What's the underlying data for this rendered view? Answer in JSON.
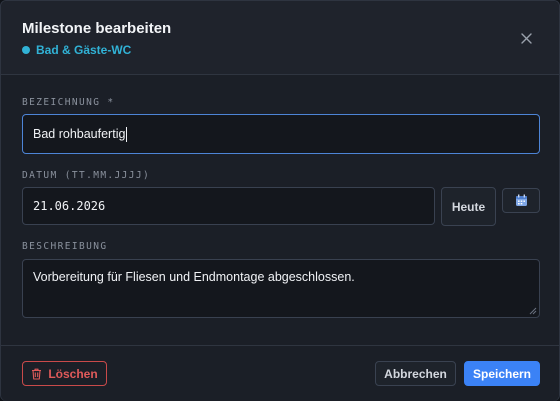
{
  "dialog": {
    "title": "Milestone bearbeiten",
    "subtitle": "Bad & Gäste-WC",
    "close_icon": "×"
  },
  "fields": {
    "name_label": "BEZEICHNUNG *",
    "name_value": "Bad rohbaufertig",
    "date_label": "DATUM (TT.MM.JJJJ)",
    "date_value": "21.06.2026",
    "today_button": "Heute",
    "description_label": "BESCHREIBUNG",
    "description_value": "Vorbereitung für Fliesen und Endmontage abgeschlossen."
  },
  "footer": {
    "delete_button": "Löschen",
    "cancel_button": "Abbrechen",
    "save_button": "Speichern"
  },
  "colors": {
    "accent": "#31b2d6",
    "primary": "#3b82f6",
    "danger": "#e05a5a",
    "focus_border": "#4d84d6"
  },
  "icons": {
    "subtitle_marker": "dot-icon",
    "close": "close-icon",
    "calendar": "calendar-icon",
    "delete": "trash-icon"
  }
}
